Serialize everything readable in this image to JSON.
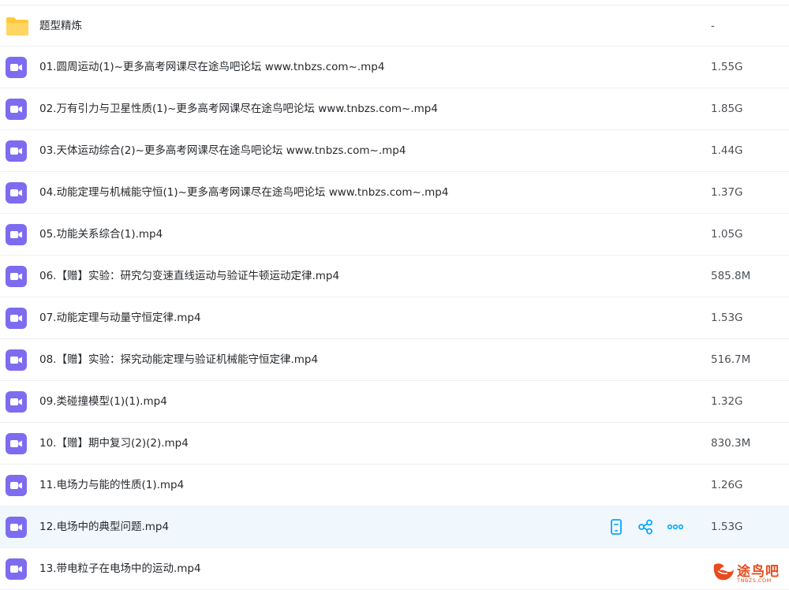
{
  "files": [
    {
      "name": "题型精炼",
      "size": "-",
      "type": "folder"
    },
    {
      "name": "01.圆周运动(1)~更多高考网课尽在途鸟吧论坛 www.tnbzs.com~.mp4",
      "size": "1.55G",
      "type": "video"
    },
    {
      "name": "02.万有引力与卫星性质(1)~更多高考网课尽在途鸟吧论坛 www.tnbzs.com~.mp4",
      "size": "1.85G",
      "type": "video"
    },
    {
      "name": "03.天体运动综合(2)~更多高考网课尽在途鸟吧论坛 www.tnbzs.com~.mp4",
      "size": "1.44G",
      "type": "video"
    },
    {
      "name": "04.动能定理与机械能守恒(1)~更多高考网课尽在途鸟吧论坛 www.tnbzs.com~.mp4",
      "size": "1.37G",
      "type": "video"
    },
    {
      "name": "05.功能关系综合(1).mp4",
      "size": "1.05G",
      "type": "video"
    },
    {
      "name": "06.【赠】实验：研究匀变速直线运动与验证牛顿运动定律.mp4",
      "size": "585.8M",
      "type": "video"
    },
    {
      "name": "07.动能定理与动量守恒定律.mp4",
      "size": "1.53G",
      "type": "video"
    },
    {
      "name": "08.【赠】实验：探究动能定理与验证机械能守恒定律.mp4",
      "size": "516.7M",
      "type": "video"
    },
    {
      "name": "09.类碰撞模型(1)(1).mp4",
      "size": "1.32G",
      "type": "video"
    },
    {
      "name": "10.【赠】期中复习(2)(2).mp4",
      "size": "830.3M",
      "type": "video"
    },
    {
      "name": "11.电场力与能的性质(1).mp4",
      "size": "1.26G",
      "type": "video"
    },
    {
      "name": "12.电场中的典型问题.mp4",
      "size": "1.53G",
      "type": "video",
      "hovered": true
    },
    {
      "name": "13.带电粒子在电场中的运动.mp4",
      "size": "",
      "type": "video"
    }
  ],
  "row_actions": [
    {
      "icon": "phone-icon"
    },
    {
      "icon": "share-icon"
    },
    {
      "icon": "more-icon"
    }
  ],
  "watermark": {
    "text": "途鸟吧",
    "sub": "TNBZS.COM"
  },
  "colors": {
    "folder": "#ffc93b",
    "video": "#7d6cf0",
    "action": "#06a7ff",
    "hover_row": "#f1f8fd",
    "watermark": "#e84b1e"
  }
}
